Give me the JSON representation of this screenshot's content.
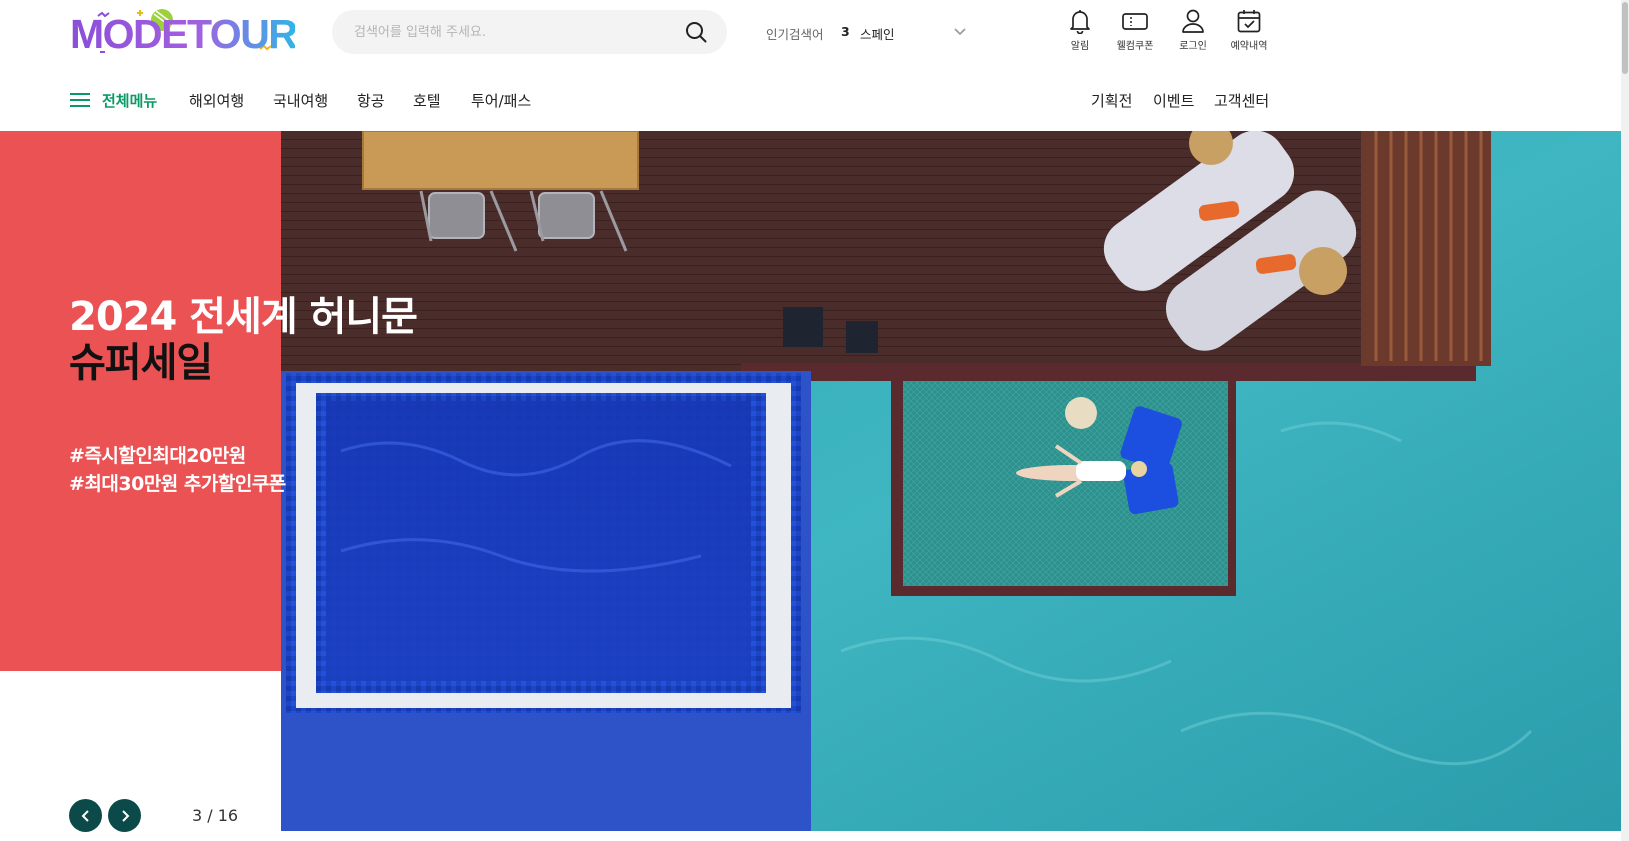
{
  "brand": {
    "logo_text": "MODETOUR"
  },
  "search": {
    "placeholder": "검색어를 입력해 주세요."
  },
  "popular": {
    "label": "인기검색어",
    "rank": "3",
    "term": "스페인"
  },
  "utility": [
    {
      "label": "알림",
      "icon": "bell-icon"
    },
    {
      "label": "웰컴쿠폰",
      "icon": "coupon-icon"
    },
    {
      "label": "로그인",
      "icon": "user-icon"
    },
    {
      "label": "예약내역",
      "icon": "calendar-check-icon"
    }
  ],
  "nav": {
    "all_menu": "전체메뉴",
    "items": [
      "해외여행",
      "국내여행",
      "항공",
      "호텔",
      "투어/패스"
    ],
    "right_items": [
      "기획전",
      "이벤트",
      "고객센터"
    ]
  },
  "hero": {
    "title_line1": "2024 전세계 허니문",
    "title_line2": "슈퍼세일",
    "tag1": "#즉시할인최대20만원",
    "tag2": "#최대30만원 추가할인쿠폰",
    "counter": "3 / 16"
  },
  "colors": {
    "accent_green": "#0b9a66",
    "hero_red": "#ea5254",
    "slider_button": "#0c4a49"
  }
}
